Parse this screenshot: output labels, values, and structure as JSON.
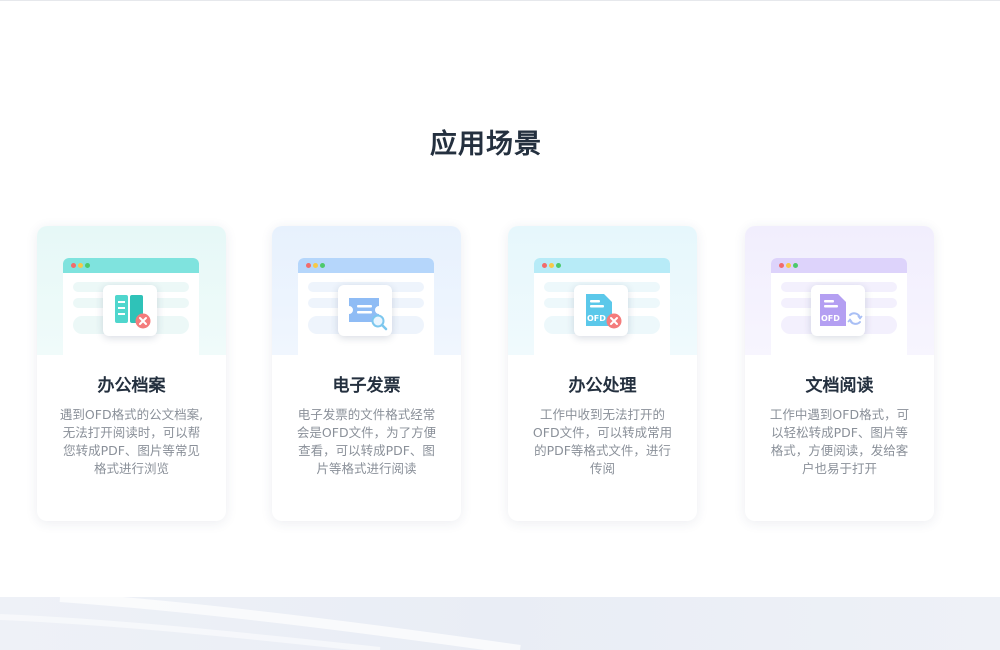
{
  "section": {
    "title": "应用场景"
  },
  "cards": [
    {
      "title": "办公档案",
      "description": "遇到OFD格式的公文档案, 无法打开阅读时，可以帮 您转成PDF、图片等常见 格式进行浏览",
      "icon": "book-error-icon",
      "accent": "#7fe3de"
    },
    {
      "title": "电子发票",
      "description": "电子发票的文件格式经常会是OFD文件，为了方便查看，可以转成PDF、图片等格式进行阅读",
      "icon": "invoice-search-icon",
      "accent": "#b5d6fb"
    },
    {
      "title": "办公处理",
      "description": "工作中收到无法打开的OFD文件，可以转成常用的PDF等格式文件，进行传阅",
      "icon": "ofd-error-icon",
      "accent": "#b7ebf7"
    },
    {
      "title": "文档阅读",
      "description": "工作中遇到OFD格式，可以轻松转成PDF、图片等格式，方便阅读，发给客户也易于打开",
      "icon": "ofd-convert-icon",
      "accent": "#ddd3fb"
    }
  ]
}
